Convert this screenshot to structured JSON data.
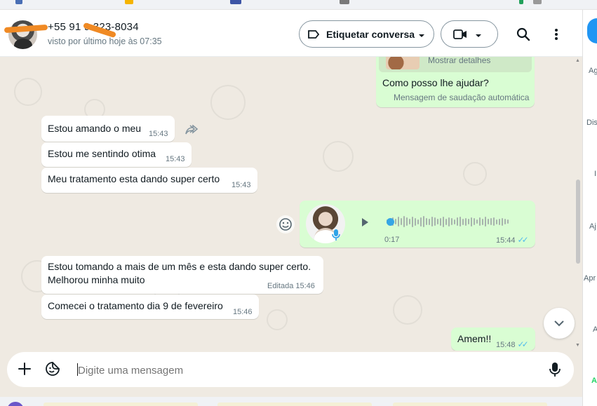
{
  "header": {
    "contact_name": "+55 91 9 323-8034",
    "contact_status": "visto por último hoje às 07:35",
    "label_button": "Etiquetar conversa"
  },
  "right_panel": {
    "items": [
      "Ag",
      "Dis",
      "I",
      "Aj",
      "Apr",
      "A",
      "A"
    ]
  },
  "messages": {
    "greeting": {
      "details": "Mostrar detalhes",
      "text": "Como posso lhe ajudar?",
      "caption": "Mensagem de saudação automática"
    },
    "m1": {
      "text": "Estou amando  o meu",
      "time": "15:43"
    },
    "m2": {
      "text": "Estou me sentindo  otima",
      "time": "15:43"
    },
    "m3": {
      "text": "Meu tratamento  esta dando super certo",
      "time": "15:43"
    },
    "voice": {
      "duration": "0:17",
      "time": "15:44"
    },
    "m4": {
      "line1": "Estou tomando a mais de um mês  e esta dando super certo.",
      "line2": "Melhorou minha muito",
      "edited": "Editada",
      "time": "15:46"
    },
    "m5": {
      "text": "Comecei o tratamento  dia 9 de fevereiro",
      "time": "15:46"
    },
    "m6": {
      "text": "Amem!!",
      "time": "15:48"
    }
  },
  "composer": {
    "placeholder": "Digite uma mensagem"
  },
  "colors": {
    "incoming_bubble": "#ffffff",
    "outgoing_bubble": "#d9fdd3",
    "chat_background": "#efeae2",
    "read_ticks": "#53bdeb",
    "redaction": "#f08a24"
  }
}
